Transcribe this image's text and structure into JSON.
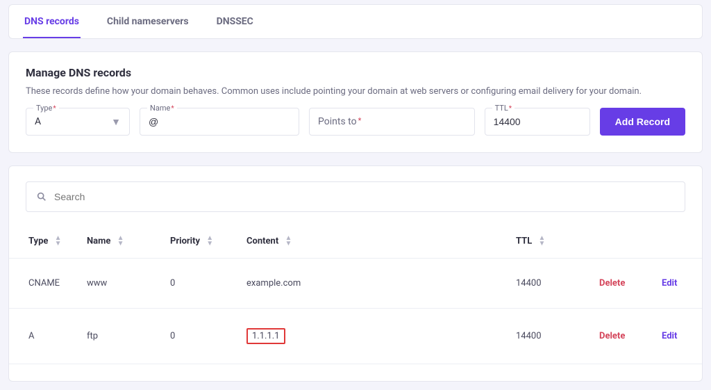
{
  "tabs": {
    "dns_records": "DNS records",
    "child_nameservers": "Child nameservers",
    "dnssec": "DNSSEC"
  },
  "manage": {
    "title": "Manage DNS records",
    "description": "These records define how your domain behaves. Common uses include pointing your domain at web servers or configuring email delivery for your domain.",
    "type_label": "Type",
    "type_value": "A",
    "name_label": "Name",
    "name_value": "@",
    "points_to_label": "Points to",
    "ttl_label": "TTL",
    "ttl_value": "14400",
    "add_button": "Add Record"
  },
  "search": {
    "placeholder": "Search"
  },
  "table": {
    "headers": {
      "type": "Type",
      "name": "Name",
      "priority": "Priority",
      "content": "Content",
      "ttl": "TTL"
    },
    "actions": {
      "delete": "Delete",
      "edit": "Edit"
    },
    "rows": [
      {
        "type": "CNAME",
        "name": "www",
        "priority": "0",
        "content": "example.com",
        "ttl": "14400",
        "highlight": false
      },
      {
        "type": "A",
        "name": "ftp",
        "priority": "0",
        "content": "1.1.1.1",
        "ttl": "14400",
        "highlight": true
      }
    ]
  }
}
